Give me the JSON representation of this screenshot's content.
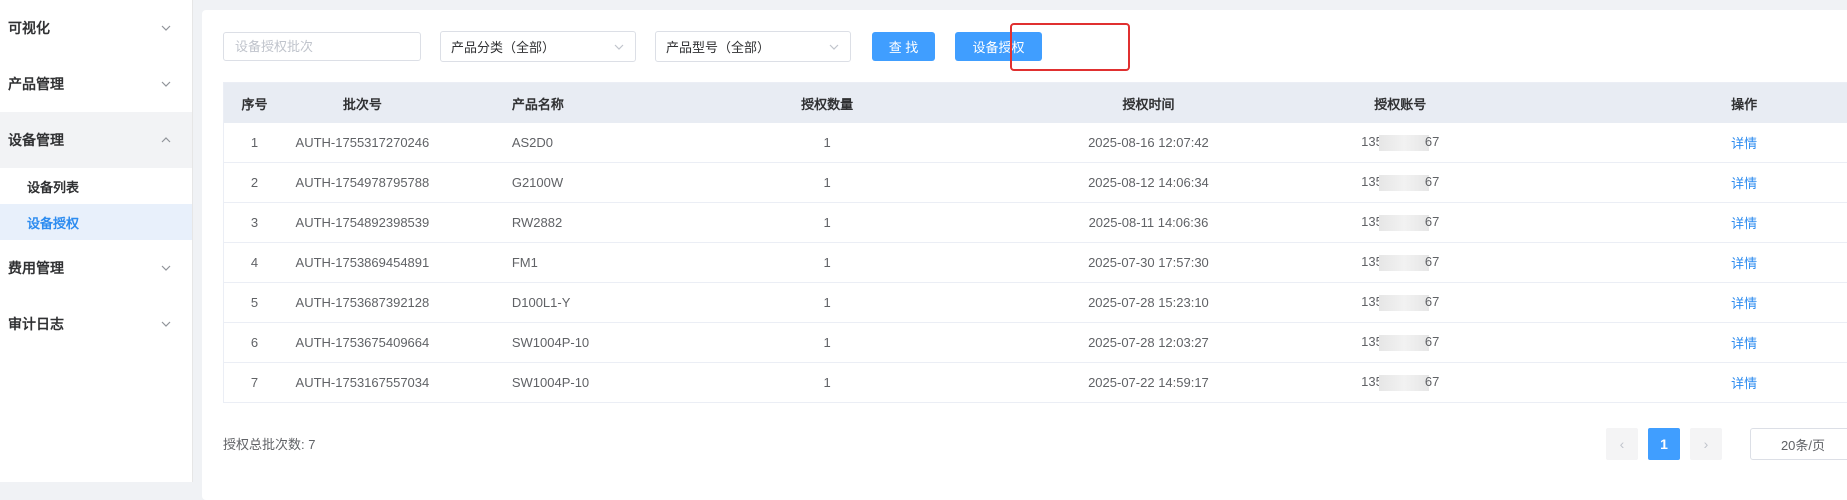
{
  "sidebar": {
    "groups": [
      {
        "label": "可视化",
        "open": false
      },
      {
        "label": "产品管理",
        "open": false
      },
      {
        "label": "设备管理",
        "open": true,
        "items": [
          {
            "label": "设备列表",
            "active": false
          },
          {
            "label": "设备授权",
            "active": true
          }
        ]
      },
      {
        "label": "费用管理",
        "open": false
      },
      {
        "label": "审计日志",
        "open": false
      }
    ]
  },
  "toolbar": {
    "batch_input_placeholder": "设备授权批次",
    "category_select": "产品分类（全部）",
    "model_select": "产品型号（全部）",
    "search_button": "查 找",
    "authorize_button": "设备授权"
  },
  "table": {
    "headers": [
      "序号",
      "批次号",
      "产品名称",
      "授权数量",
      "授权时间",
      "授权账号",
      "操作"
    ],
    "rows": [
      {
        "no": "1",
        "batch": "AUTH-1755317270246",
        "product": "AS2D0",
        "count": "1",
        "time": "2025-08-16 12:07:42",
        "acc_prefix": "135",
        "acc_suffix": "67",
        "action": "详情"
      },
      {
        "no": "2",
        "batch": "AUTH-1754978795788",
        "product": "G2100W",
        "count": "1",
        "time": "2025-08-12 14:06:34",
        "acc_prefix": "135",
        "acc_suffix": "67",
        "action": "详情"
      },
      {
        "no": "3",
        "batch": "AUTH-1754892398539",
        "product": "RW2882",
        "count": "1",
        "time": "2025-08-11 14:06:36",
        "acc_prefix": "135",
        "acc_suffix": "67",
        "action": "详情"
      },
      {
        "no": "4",
        "batch": "AUTH-1753869454891",
        "product": "FM1",
        "count": "1",
        "time": "2025-07-30 17:57:30",
        "acc_prefix": "135",
        "acc_suffix": "67",
        "action": "详情"
      },
      {
        "no": "5",
        "batch": "AUTH-1753687392128",
        "product": "D100L1-Y",
        "count": "1",
        "time": "2025-07-28 15:23:10",
        "acc_prefix": "135",
        "acc_suffix": "67",
        "action": "详情"
      },
      {
        "no": "6",
        "batch": "AUTH-1753675409664",
        "product": "SW1004P-10",
        "count": "1",
        "time": "2025-07-28 12:03:27",
        "acc_prefix": "135",
        "acc_suffix": "67",
        "action": "详情"
      },
      {
        "no": "7",
        "batch": "AUTH-1753167557034",
        "product": "SW1004P-10",
        "count": "1",
        "time": "2025-07-22 14:59:17",
        "acc_prefix": "135",
        "acc_suffix": "67",
        "action": "详情"
      }
    ]
  },
  "footer": {
    "total_label": "授权总批次数: 7",
    "current_page": "1",
    "page_size": "20条/页",
    "prev_icon": "‹",
    "next_icon": "›"
  },
  "colors": {
    "accent": "#409eff",
    "highlight": "#e03030",
    "link": "#2d8cf0"
  }
}
